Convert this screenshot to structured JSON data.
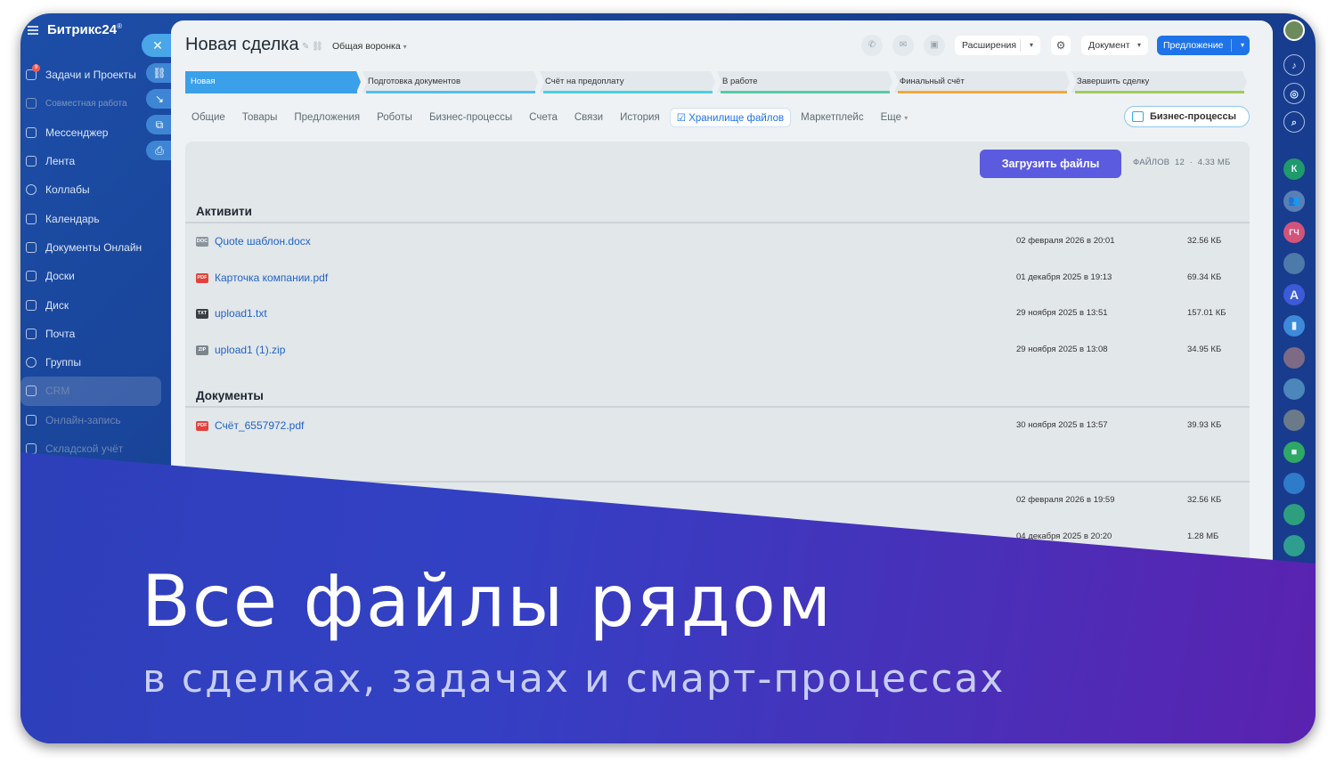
{
  "sidebar": {
    "logo": "Битрикс24",
    "logo_mark": "®",
    "badge": "9",
    "items": [
      {
        "label": "Задачи и Проекты",
        "icon": "tasks-icon"
      },
      {
        "label": "Совместная работа",
        "icon": "collab-icon"
      },
      {
        "label": "Мессенджер",
        "icon": "messenger-icon"
      },
      {
        "label": "Лента",
        "icon": "feed-icon"
      },
      {
        "label": "Коллабы",
        "icon": "collabs-icon"
      },
      {
        "label": "Календарь",
        "icon": "calendar-icon"
      },
      {
        "label": "Документы Онлайн",
        "icon": "documents-icon"
      },
      {
        "label": "Доски",
        "icon": "boards-icon"
      },
      {
        "label": "Диск",
        "icon": "disk-icon"
      },
      {
        "label": "Почта",
        "icon": "mail-icon"
      },
      {
        "label": "Группы",
        "icon": "groups-icon"
      },
      {
        "label": "CRM",
        "icon": "crm-icon"
      },
      {
        "label": "Онлайн-запись",
        "icon": "booking-icon"
      },
      {
        "label": "Складской учёт",
        "icon": "inventory-icon"
      }
    ]
  },
  "rail": {
    "avatar_letters": [
      "К",
      "ГЧ",
      "A"
    ]
  },
  "header": {
    "title": "Новая сделка",
    "funnel": "Общая воронка",
    "extensions_label": "Расширения",
    "document_label": "Документ",
    "offer_label": "Предложение"
  },
  "stages": [
    {
      "label": "Новая",
      "color": "#3aa0ea"
    },
    {
      "label": "Подготовка документов",
      "color": "#51c0e8"
    },
    {
      "label": "Счёт на предоплату",
      "color": "#47d1e2"
    },
    {
      "label": "В работе",
      "color": "#56cba5"
    },
    {
      "label": "Финальный счёт",
      "color": "#f2a93b"
    },
    {
      "label": "Завершить сделку",
      "color": "#a0cc58"
    }
  ],
  "tabs": [
    "Общие",
    "Товары",
    "Предложения",
    "Роботы",
    "Бизнес-процессы",
    "Счета",
    "Связи",
    "История",
    "Хранилище файлов",
    "Маркетплейс",
    "Еще"
  ],
  "active_tab": "Хранилище файлов",
  "bp_button": "Бизнес-процессы",
  "files_panel": {
    "upload_label": "Загрузить файлы",
    "files_label": "ФАЙЛОВ",
    "files_count": "12",
    "total_size": "4.33 МБ"
  },
  "sections": [
    {
      "title": "Активити",
      "files": [
        {
          "type": "DOC",
          "name": "Quote шаблон.docx",
          "date": "02 февраля 2026 в 20:01",
          "size": "32.56 КБ"
        },
        {
          "type": "PDF",
          "name": "Карточка компании.pdf",
          "date": "01 декабря 2025 в 19:13",
          "size": "69.34 КБ"
        },
        {
          "type": "TXT",
          "name": "upload1.txt",
          "date": "29 ноября 2025 в 13:51",
          "size": "157.01 КБ"
        },
        {
          "type": "ZIP",
          "name": "upload1 (1).zip",
          "date": "29 ноября 2025 в 13:08",
          "size": "34.95 КБ"
        }
      ]
    },
    {
      "title": "Документы",
      "files": [
        {
          "type": "PDF",
          "name": "Счёт_6557972.pdf",
          "date": "30 ноября 2025 в 13:57",
          "size": "39.93 КБ"
        }
      ]
    }
  ],
  "hidden_rows": [
    {
      "date": "02 февраля 2026 в 19:59",
      "size": "32.56 КБ"
    },
    {
      "date": "04 декабря 2025 в 20:20",
      "size": "1.28 МБ"
    }
  ],
  "banner": {
    "title": "Все файлы рядом",
    "subtitle": "в сделках, задачах и смарт-процессах"
  }
}
